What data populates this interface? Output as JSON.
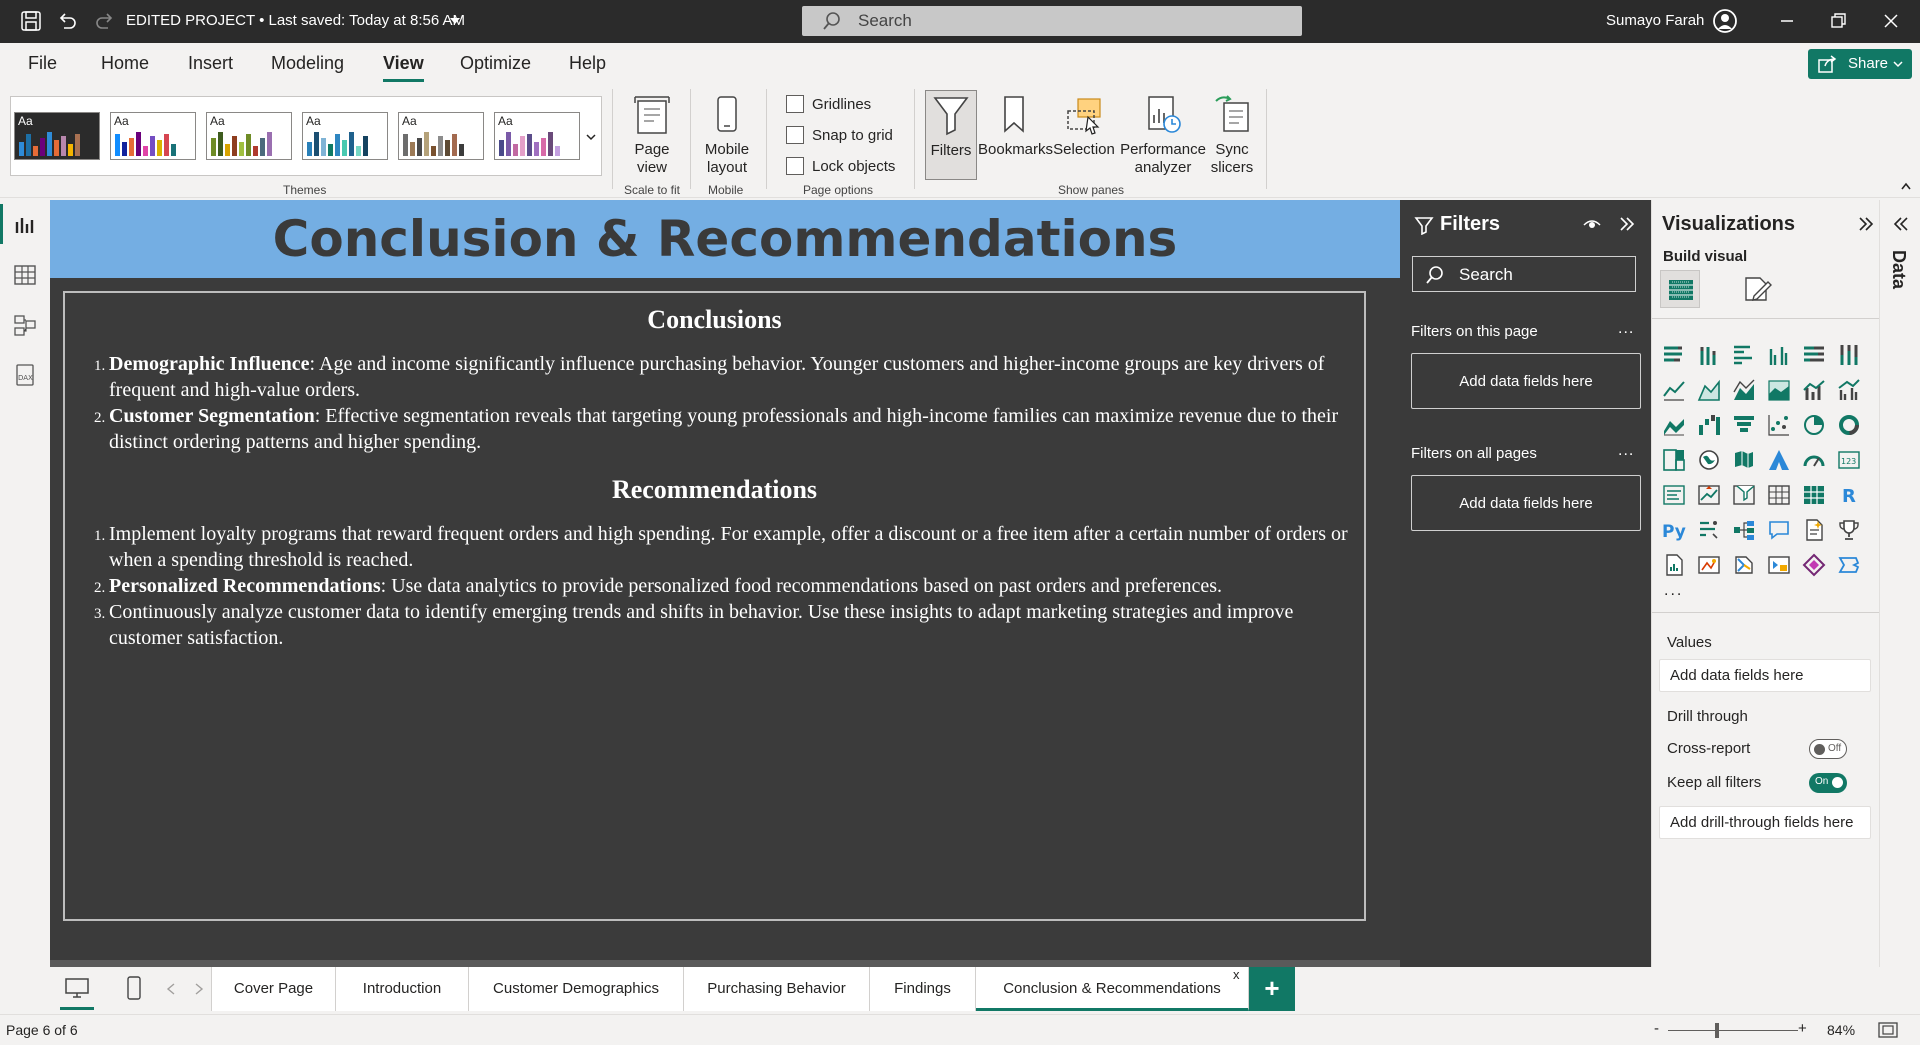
{
  "titlebar": {
    "doc_title": "EDITED PROJECT • Last saved: Today at 8:56 AM",
    "search_placeholder": "Search",
    "user_name": "Sumayo Farah"
  },
  "menu": {
    "items": [
      "File",
      "Home",
      "Insert",
      "Modeling",
      "View",
      "Optimize",
      "Help"
    ],
    "active": "View",
    "share_label": "Share"
  },
  "ribbon": {
    "themes_label": "Themes",
    "themes_sample": "Aa",
    "page_view_label": "Page view",
    "scale_to_fit_label": "Scale to fit",
    "mobile_layout_label": "Mobile layout",
    "mobile_label": "Mobile",
    "gridlines_label": "Gridlines",
    "snap_label": "Snap to grid",
    "lock_label": "Lock objects",
    "page_options_label": "Page options",
    "filters_label": "Filters",
    "bookmarks_label": "Bookmarks",
    "selection_label": "Selection",
    "performance_label": "Performance analyzer",
    "sync_label": "Sync slicers",
    "show_panes_label": "Show panes"
  },
  "report": {
    "title": "Conclusion & Recommendations",
    "conclusions_heading": "Conclusions",
    "conclusions": [
      {
        "bold": "Demographic Influence",
        "text": ": Age and income significantly influence purchasing behavior. Younger customers and higher-income groups are key drivers of frequent and high-value orders."
      },
      {
        "bold": "Customer Segmentation",
        "text": ": Effective segmentation reveals that targeting young professionals and high-income families can maximize revenue due to their distinct ordering patterns and higher spending."
      }
    ],
    "recommendations_heading": "Recommendations",
    "recommendations": [
      {
        "bold": "",
        "text": "Implement loyalty programs that reward frequent orders and high spending. For example, offer a discount or a free item after a certain number of orders or when a spending threshold is reached."
      },
      {
        "bold": "Personalized Recommendations",
        "text": ": Use data analytics to provide personalized food recommendations based on past orders and preferences."
      },
      {
        "bold": "",
        "text": "Continuously analyze customer data to identify emerging trends and shifts in behavior. Use these insights to adapt marketing strategies and improve customer satisfaction."
      }
    ]
  },
  "filters": {
    "title": "Filters",
    "search_placeholder": "Search",
    "on_this_page": "Filters on this page",
    "on_all_pages": "Filters on all pages",
    "add_fields": "Add data fields here",
    "more": "..."
  },
  "visualizations": {
    "title": "Visualizations",
    "build_visual": "Build visual",
    "more": "...",
    "values_label": "Values",
    "values_well": "Add data fields here",
    "drill_through": "Drill through",
    "cross_report": "Cross-report",
    "cross_report_state": "Off",
    "keep_all_filters": "Keep all filters",
    "keep_all_filters_state": "On",
    "drill_well": "Add drill-through fields here"
  },
  "data_pane": {
    "label": "Data"
  },
  "tabs": {
    "items": [
      "Cover Page",
      "Introduction",
      "Customer Demographics",
      "Purchasing Behavior",
      "Findings",
      "Conclusion & Recommendations"
    ],
    "active": "Conclusion & Recommendations",
    "close_glyph": "x",
    "add_glyph": "+"
  },
  "status": {
    "page": "Page 6 of 6",
    "zoom": "84%",
    "zoom_minus": "-",
    "zoom_plus": "+"
  },
  "colors": {
    "accent": "#117865",
    "canvas_bg": "#3b3b3b",
    "banner_bg": "#74aee3"
  }
}
